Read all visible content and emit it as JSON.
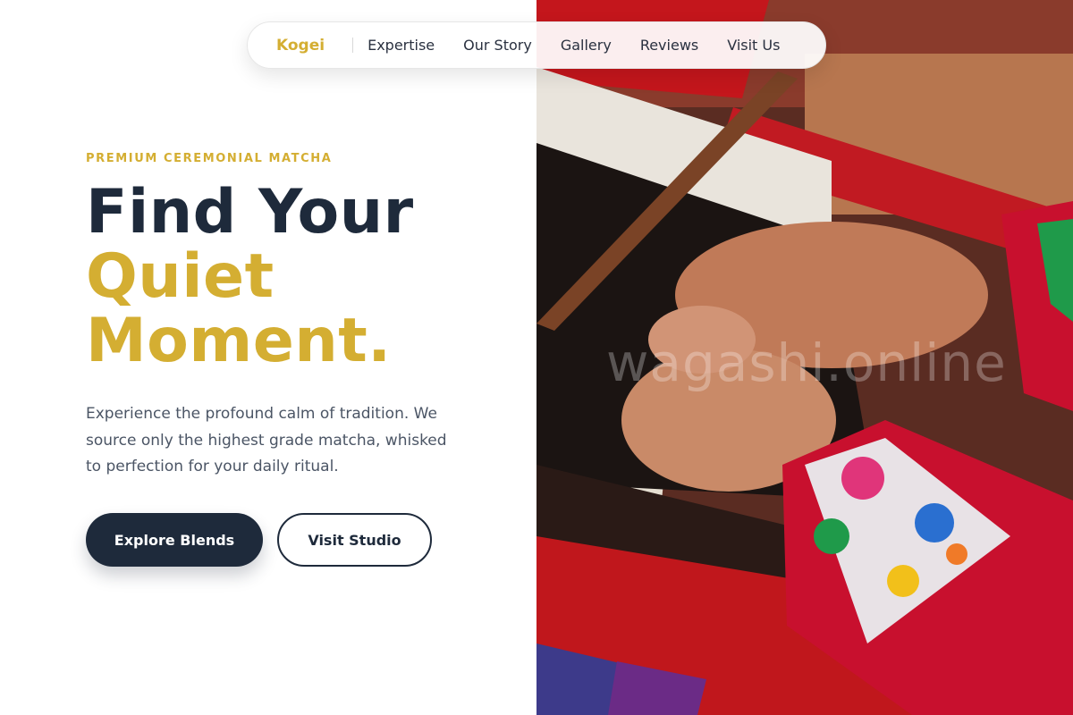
{
  "nav": {
    "brand": "Kogei",
    "links": [
      "Expertise",
      "Our Story",
      "Gallery",
      "Reviews",
      "Visit Us"
    ]
  },
  "hero": {
    "eyebrow": "PREMIUM CEREMONIAL MATCHA",
    "headline_line1": "Find Your",
    "headline_line2": "Quiet",
    "headline_line3": "Moment.",
    "body": "Experience the profound calm of tradition. We source only the highest grade matcha, whisked to perfection for your daily ritual.",
    "primary_button": "Explore Blends",
    "secondary_button": "Visit Studio"
  },
  "image": {
    "watermark": "wagashi.online",
    "subject": "hands weaving on a loom, embroidered red sleeve"
  },
  "colors": {
    "accent_gold": "#d4ae32",
    "navy": "#1e2a3b",
    "body_text": "#4b5565"
  }
}
